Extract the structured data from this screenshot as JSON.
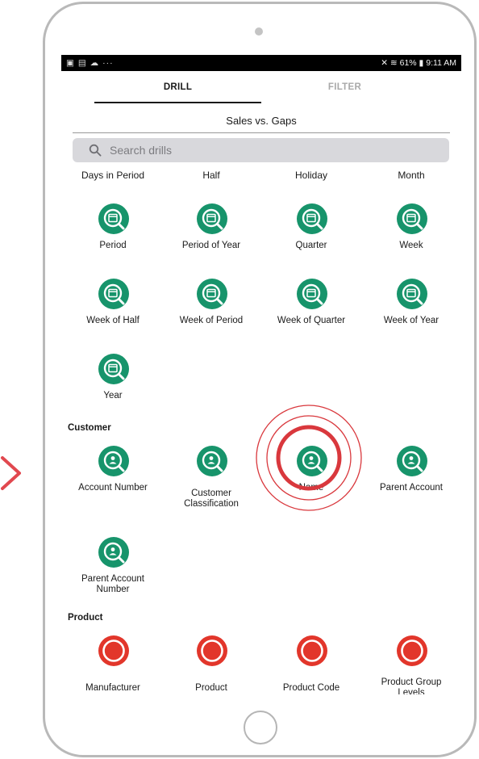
{
  "status_bar": {
    "left_icons": "▣ ▤ ☁ ···",
    "right": "✕ ≋ 61% ▮ 9:11 AM"
  },
  "tabs": [
    {
      "label": "DRILL"
    },
    {
      "label": "FILTER"
    }
  ],
  "subject_area": "Sales vs. Gaps",
  "search": {
    "placeholder": "Search drills"
  },
  "time_drills": {
    "header_row": [
      "Days in Period",
      "Half",
      "Holiday",
      "Month"
    ],
    "items": [
      {
        "label": "Period",
        "icon": "calendar-search-icon"
      },
      {
        "label": "Period of Year",
        "icon": "calendar-search-icon"
      },
      {
        "label": "Quarter",
        "icon": "calendar-search-icon"
      },
      {
        "label": "Week",
        "icon": "calendar-search-icon"
      },
      {
        "label": "Week of Half",
        "icon": "calendar-search-icon"
      },
      {
        "label": "Week of Period",
        "icon": "calendar-search-icon"
      },
      {
        "label": "Week of Quarter",
        "icon": "calendar-search-icon"
      },
      {
        "label": "Week of Year",
        "icon": "calendar-search-icon"
      },
      {
        "label": "Year",
        "icon": "calendar-search-icon"
      }
    ]
  },
  "customer": {
    "heading": "Customer",
    "items": [
      {
        "label": "Account Number",
        "icon": "person-search-icon"
      },
      {
        "label": "Customer Classification",
        "icon": "person-search-icon"
      },
      {
        "label": "Name",
        "icon": "person-search-icon"
      },
      {
        "label": "Parent Account",
        "icon": "person-search-icon"
      },
      {
        "label": "Parent Account Number",
        "icon": "person-search-icon"
      }
    ]
  },
  "product": {
    "heading": "Product",
    "items": [
      {
        "label": "Manufacturer",
        "icon": "product-circle-icon"
      },
      {
        "label": "Product",
        "icon": "product-circle-icon"
      },
      {
        "label": "Product Code",
        "icon": "product-circle-icon"
      },
      {
        "label": "Product Group Levels",
        "icon": "product-circle-icon"
      }
    ]
  },
  "colors": {
    "drill_green": "#17946b",
    "product_red": "#e2362b",
    "tap_highlight": "#d9383d",
    "device_frame": "#b9b9b9"
  }
}
